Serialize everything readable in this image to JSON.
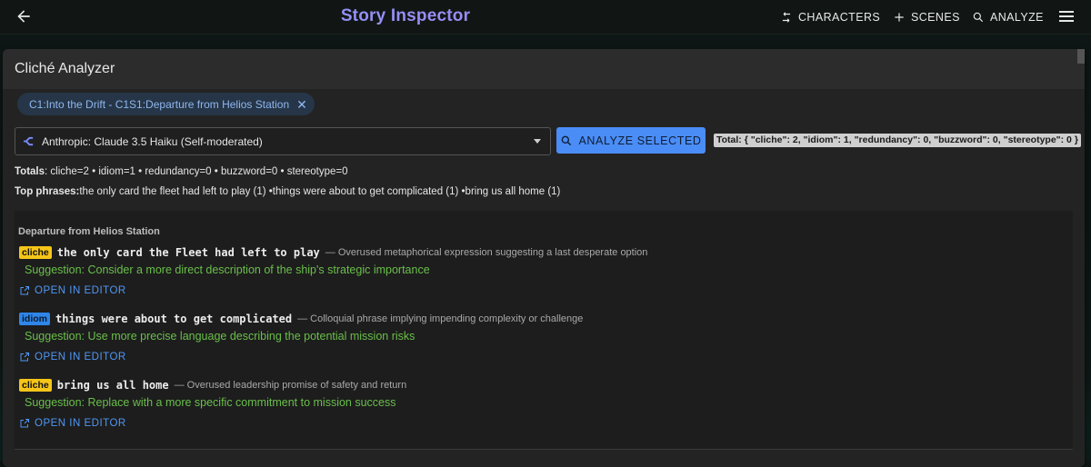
{
  "header": {
    "title": "Story Inspector",
    "nav": [
      {
        "label": "CHARACTERS",
        "icon": "swap-icon"
      },
      {
        "label": "SCENES",
        "icon": "plus-icon"
      },
      {
        "label": "ANALYZE",
        "icon": "search-icon"
      }
    ]
  },
  "panel": {
    "title": "Cliché Analyzer",
    "chip": "C1:Into the Drift - C1S1:Departure from Helios Station",
    "model": "Anthropic: Claude 3.5 Haiku (Self-moderated)",
    "analyze_label": "ANALYZE SELECTED",
    "json_summary": "Total: { \"cliche\": 2, \"idiom\": 1, \"redundancy\": 0, \"buzzword\": 0, \"stereotype\": 0 }",
    "totals_label": "Totals",
    "totals_text": ": cliche=2 • idiom=1 • redundancy=0 • buzzword=0 • stereotype=0",
    "top_label": "Top phrases:",
    "top_text": "the only card the fleet had left to play (1) •things were about to get complicated (1) •bring us all home (1)"
  },
  "results": {
    "scene": "Departure from Helios Station",
    "open_label": "OPEN IN EDITOR",
    "items": [
      {
        "tag": "cliche",
        "phrase": "the only card the Fleet had left to play",
        "desc": "— Overused metaphorical expression suggesting a last desperate option",
        "suggestion": "Suggestion: Consider a more direct description of the ship's strategic importance"
      },
      {
        "tag": "idiom",
        "phrase": "things were about to get complicated",
        "desc": "— Colloquial phrase implying impending complexity or challenge",
        "suggestion": "Suggestion: Use more precise language describing the potential mission risks"
      },
      {
        "tag": "cliche",
        "phrase": "bring us all home",
        "desc": "— Overused leadership promise of safety and return",
        "suggestion": "Suggestion: Replace with a more specific commitment to mission success"
      }
    ]
  },
  "colors": {
    "accent": "#4a8df6",
    "cliche": "#f5c518",
    "idiom": "#2f86e9",
    "suggestion": "#6abf4b"
  }
}
